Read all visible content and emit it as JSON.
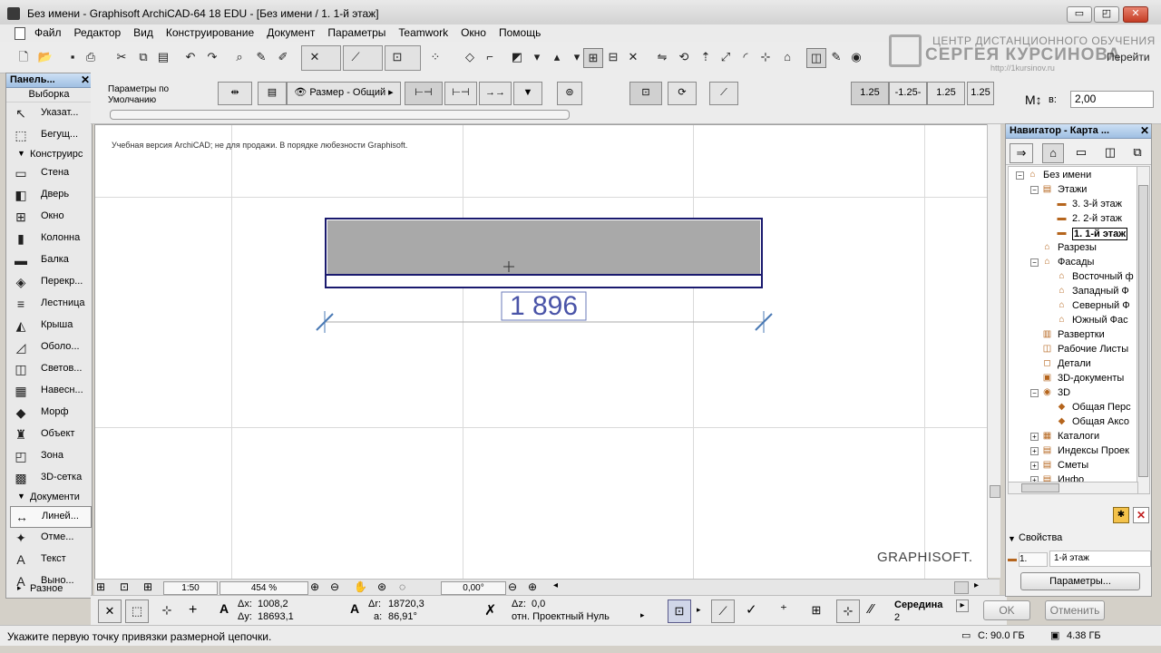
{
  "window": {
    "title": "Без имени - Graphisoft ArchiCAD-64 18 EDU - [Без имени / 1. 1-й этаж]",
    "buttons": [
      "▭",
      "◰",
      "✕"
    ]
  },
  "menu": [
    "Файл",
    "Редактор",
    "Вид",
    "Конструирование",
    "Документ",
    "Параметры",
    "Teamwork",
    "Окно",
    "Помощь"
  ],
  "watermark": {
    "line1": "ЦЕНТР ДИСТАНЦИОННОГО ОБУЧЕНИЯ",
    "line2": "СЕРГЕЯ КУРСИНОВА",
    "line3": "http://1kursinov.ru",
    "goto": "Перейти"
  },
  "toolbox": {
    "title": "Панель...",
    "select_label": "Выборка",
    "top_tools": [
      {
        "icon": "↖",
        "label": "Указат..."
      },
      {
        "icon": "⬚",
        "label": "Бегущ..."
      }
    ],
    "construct_section": "Конструирс",
    "construct_tools": [
      {
        "icon": "▭",
        "label": "Стена"
      },
      {
        "icon": "◧",
        "label": "Дверь"
      },
      {
        "icon": "⊞",
        "label": "Окно"
      },
      {
        "icon": "▮",
        "label": "Колонна"
      },
      {
        "icon": "▬",
        "label": "Балка"
      },
      {
        "icon": "◈",
        "label": "Перекр..."
      },
      {
        "icon": "≡",
        "label": "Лестница"
      },
      {
        "icon": "◭",
        "label": "Крыша"
      },
      {
        "icon": "◿",
        "label": "Оболо..."
      },
      {
        "icon": "◫",
        "label": "Светов..."
      },
      {
        "icon": "▦",
        "label": "Навесн..."
      },
      {
        "icon": "◆",
        "label": "Морф"
      },
      {
        "icon": "♜",
        "label": "Объект"
      },
      {
        "icon": "◰",
        "label": "Зона"
      },
      {
        "icon": "▩",
        "label": "3D-сетка"
      }
    ],
    "document_section": "Документи",
    "document_tools": [
      {
        "icon": "↔",
        "label": "Линей...",
        "active": true
      },
      {
        "icon": "✦",
        "label": "Отме..."
      },
      {
        "icon": "A",
        "label": "Текст"
      },
      {
        "icon": "A",
        "label": "Выно..."
      }
    ],
    "misc_section": "Разное"
  },
  "infobox": {
    "params_label": "Параметры по Умолчанию",
    "dimension_label": "Размер - Общий",
    "scale_values": [
      "1.25",
      "-1.25-",
      "1.25",
      "1.25"
    ],
    "mv_label": "в:",
    "mv_value": "2,00"
  },
  "canvas": {
    "notice": "Учебная версия ArchiCAD; не для продажи. В порядке любезности Graphisoft.",
    "dimension_text": "1 896",
    "brand": "GRAPHISOFT."
  },
  "navbar": {
    "scale": "1:50",
    "zoom": "454 %",
    "angle": "0,00°"
  },
  "coords": {
    "dx_label": "Δx:",
    "dx": "1008,2",
    "dy_label": "Δy:",
    "dy": "18693,1",
    "dr_label": "Δr:",
    "dr": "18720,3",
    "a_label": "a:",
    "a": "86,91°",
    "dz_label": "Δz:",
    "dz": "0,0",
    "ref": "отн. Проектный Нуль",
    "snap_label": "Середина",
    "snap_num": "2"
  },
  "dialog": {
    "ok": "OK",
    "cancel": "Отменить"
  },
  "navigator": {
    "title": "Навигатор - Карта ...",
    "tree": [
      {
        "level": 0,
        "exp": "−",
        "icon": "⌂",
        "label": "Без имени"
      },
      {
        "level": 1,
        "exp": "−",
        "icon": "▤",
        "label": "Этажи"
      },
      {
        "level": 2,
        "icon": "▬",
        "label": "3. 3-й этаж"
      },
      {
        "level": 2,
        "icon": "▬",
        "label": "2. 2-й этаж"
      },
      {
        "level": 2,
        "icon": "▬",
        "label": "1. 1-й этаж",
        "selected": true
      },
      {
        "level": 1,
        "icon": "⌂",
        "label": "Разрезы"
      },
      {
        "level": 1,
        "exp": "−",
        "icon": "⌂",
        "label": "Фасады"
      },
      {
        "level": 2,
        "icon": "⌂",
        "label": "Восточный ф"
      },
      {
        "level": 2,
        "icon": "⌂",
        "label": "Западный Ф"
      },
      {
        "level": 2,
        "icon": "⌂",
        "label": "Северный Ф"
      },
      {
        "level": 2,
        "icon": "⌂",
        "label": "Южный Фас"
      },
      {
        "level": 1,
        "icon": "▥",
        "label": "Развертки"
      },
      {
        "level": 1,
        "icon": "◫",
        "label": "Рабочие Листы"
      },
      {
        "level": 1,
        "icon": "◻",
        "label": "Детали"
      },
      {
        "level": 1,
        "icon": "▣",
        "label": "3D-документы"
      },
      {
        "level": 1,
        "exp": "−",
        "icon": "◉",
        "label": "3D"
      },
      {
        "level": 2,
        "icon": "◆",
        "label": "Общая Перс"
      },
      {
        "level": 2,
        "icon": "◆",
        "label": "Общая Аксо"
      },
      {
        "level": 1,
        "exp": "+",
        "icon": "▦",
        "label": "Каталоги"
      },
      {
        "level": 1,
        "exp": "+",
        "icon": "▤",
        "label": "Индексы Проек"
      },
      {
        "level": 1,
        "exp": "+",
        "icon": "▤",
        "label": "Сметы"
      },
      {
        "level": 1,
        "exp": "+",
        "icon": "▤",
        "label": "Инфо"
      }
    ],
    "props_label": "Свойства",
    "prop_num": "1.",
    "prop_name": "1-й этаж",
    "params_button": "Параметры..."
  },
  "status": {
    "message": "Укажите первую точку привязки размерной цепочки.",
    "disk": "C: 90.0 ГБ",
    "mem": "4.38 ГБ"
  }
}
